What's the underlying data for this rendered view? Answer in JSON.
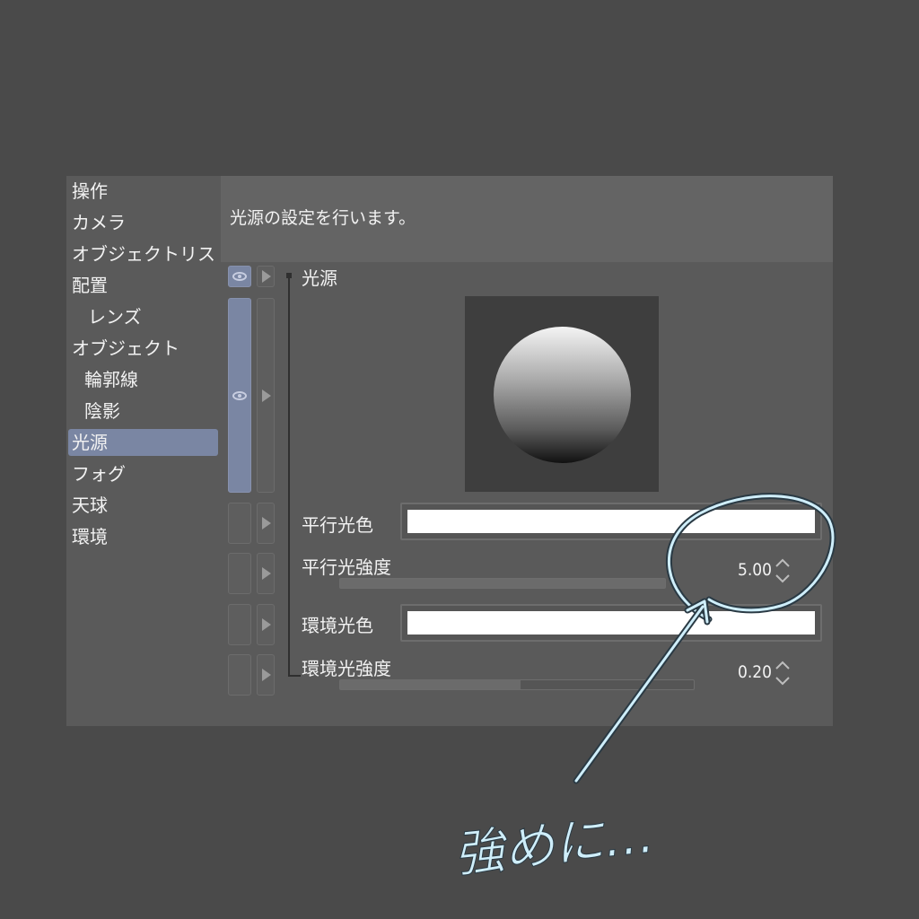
{
  "sidebar": {
    "items": [
      {
        "label": "操作",
        "sub": false,
        "selected": false
      },
      {
        "label": "カメラ",
        "sub": false,
        "selected": false
      },
      {
        "label": "オブジェクトリスト",
        "sub": false,
        "selected": false
      },
      {
        "label": "配置",
        "sub": false,
        "selected": false
      },
      {
        "label": "レンズ",
        "sub": true,
        "selected": false
      },
      {
        "label": "オブジェクト",
        "sub": false,
        "selected": false
      },
      {
        "label": "輪郭線",
        "sub": true,
        "selected": false
      },
      {
        "label": "陰影",
        "sub": true,
        "selected": false
      },
      {
        "label": "光源",
        "sub": false,
        "selected": true
      },
      {
        "label": "フォグ",
        "sub": false,
        "selected": false
      },
      {
        "label": "天球",
        "sub": false,
        "selected": false
      },
      {
        "label": "環境",
        "sub": false,
        "selected": false
      }
    ]
  },
  "description": "光源の設定を行います。",
  "light": {
    "group_label": "光源",
    "parallel_color_label": "平行光色",
    "parallel_color": "#ffffff",
    "parallel_intensity_label": "平行光強度",
    "parallel_intensity_value": "5.00",
    "parallel_intensity_fraction": 1.0,
    "ambient_color_label": "環境光色",
    "ambient_color": "#ffffff",
    "ambient_intensity_label": "環境光強度",
    "ambient_intensity_value": "0.20",
    "ambient_intensity_fraction": 0.51
  },
  "annotation": {
    "text": "強めに…",
    "color": "#cfeefa"
  },
  "colors": {
    "background": "#4a4a4a",
    "panel": "#5a5a5a",
    "selected": "#7a86a3"
  }
}
